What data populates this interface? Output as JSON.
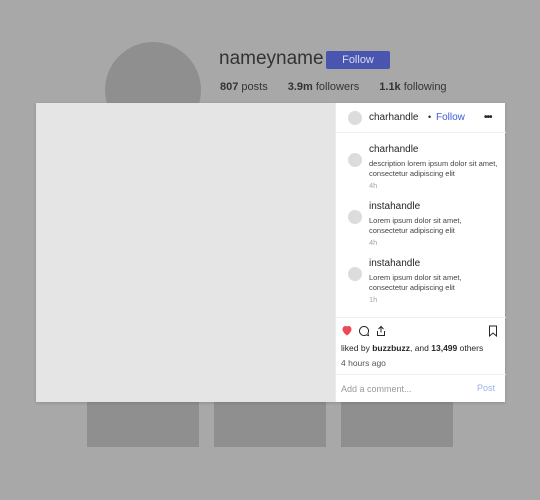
{
  "profile": {
    "username": "nameyname",
    "follow_label": "Follow",
    "stats": [
      {
        "value": "807",
        "label": "posts"
      },
      {
        "value": "3.9m",
        "label": "followers"
      },
      {
        "value": "1.1k",
        "label": "following"
      }
    ]
  },
  "post": {
    "header": {
      "handle": "charhandle",
      "separator": "•",
      "follow_label": "Follow",
      "more_icon": "more-horizontal-icon"
    },
    "comments": [
      {
        "user": "charhandle",
        "text": "description lorem ipsum dolor sit amet, consectetur adipiscing elit",
        "time": "4h"
      },
      {
        "user": "instahandle",
        "text": "Lorem ipsum dolor sit amet, consectetur adipiscing elit",
        "time": "4h"
      },
      {
        "user": "instahandle",
        "text": "Lorem ipsum dolor sit amet, consectetur adipiscing elit",
        "time": "1h"
      }
    ],
    "likes": {
      "prefix": "liked by ",
      "user": "buzzbuzz",
      "middle": ", and ",
      "count": "13,499",
      "suffix": " others"
    },
    "time_ago": "4 hours ago",
    "comment_placeholder": "Add a comment...",
    "post_label": "Post"
  },
  "colors": {
    "accent": "#3f5bd6",
    "like": "#ed4956",
    "backdrop": "#a8a8a8"
  }
}
